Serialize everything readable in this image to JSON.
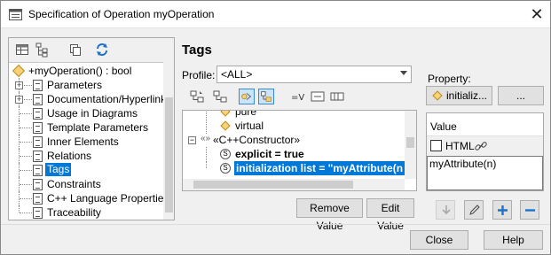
{
  "window": {
    "title": "Specification of Operation myOperation",
    "close_glyph": "✕"
  },
  "left_tree": {
    "items": [
      {
        "label": "+myOperation() : bool",
        "type": "root",
        "expander": ""
      },
      {
        "label": "Parameters",
        "type": "page",
        "expander": "+"
      },
      {
        "label": "Documentation/Hyperlinks",
        "type": "page",
        "expander": "+"
      },
      {
        "label": "Usage in Diagrams",
        "type": "page",
        "expander": ""
      },
      {
        "label": "Template Parameters",
        "type": "page",
        "expander": ""
      },
      {
        "label": "Inner Elements",
        "type": "page",
        "expander": ""
      },
      {
        "label": "Relations",
        "type": "page",
        "expander": ""
      },
      {
        "label": "Tags",
        "type": "page",
        "expander": "",
        "selected": true
      },
      {
        "label": "Constraints",
        "type": "page",
        "expander": ""
      },
      {
        "label": "C++ Language Properties",
        "type": "page",
        "expander": ""
      },
      {
        "label": "Traceability",
        "type": "page",
        "expander": ""
      }
    ]
  },
  "main": {
    "title": "Tags",
    "profile_label": "Profile:",
    "profile_value": "<ALL>",
    "tag_tree": {
      "rows": [
        {
          "text": "pure",
          "icon": "diamond"
        },
        {
          "text": "virtual",
          "icon": "diamond"
        },
        {
          "text": "«C++Constructor»",
          "icon": "stereotype",
          "expander": "−"
        },
        {
          "text_bold": "explicit = true",
          "icon": "tag"
        },
        {
          "text_bold": "initialization list = \"myAttribute(n",
          "icon": "tag",
          "selected": true
        }
      ]
    },
    "remove_value_label": "Remove Value",
    "edit_value_label": "Edit Value"
  },
  "property": {
    "label": "Property:",
    "value": "initializ...",
    "more_label": "...",
    "value_header": "Value",
    "html_label": "HTML",
    "value_text": "myAttribute(n)"
  },
  "footer": {
    "close_label": "Close",
    "help_label": "Help"
  },
  "colors": {
    "selection": "#0078d7",
    "accent": "#1e73c8"
  }
}
